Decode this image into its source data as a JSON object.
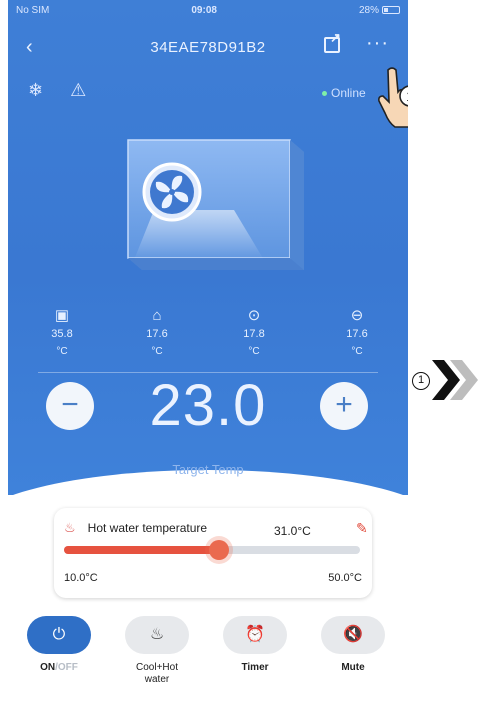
{
  "status_bar": {
    "carrier": "No SIM",
    "time": "09:08",
    "battery": "28%"
  },
  "header": {
    "title": "34EAE78D91B2",
    "back_icon": "chevron-left-icon",
    "share_icon": "share-icon",
    "more_icon": "more-dots-icon"
  },
  "device": {
    "online_text": "Online"
  },
  "step_badge": "1",
  "sensors": [
    {
      "icon": "outdoor-temp-icon",
      "value": "35.8",
      "unit": "°C"
    },
    {
      "icon": "room-temp-icon",
      "value": "17.6",
      "unit": "°C"
    },
    {
      "icon": "inlet-temp-icon",
      "value": "17.8",
      "unit": "°C"
    },
    {
      "icon": "outlet-temp-icon",
      "value": "17.6",
      "unit": "°C"
    }
  ],
  "target": {
    "value": "23.0",
    "label": "Target Temp",
    "minus": "−",
    "plus": "+"
  },
  "hot_water": {
    "label": "Hot water temperature",
    "value": "31.0°C",
    "min": "10.0°C",
    "max": "50.0°C",
    "fraction": 0.525
  },
  "controls": {
    "power": {
      "on": "ON",
      "separator": "/",
      "off": "OFF"
    },
    "mode": {
      "label_line1": "Cool+Hot",
      "label_line2": "water"
    },
    "timer": {
      "label": "Timer"
    },
    "mute": {
      "label": "Mute"
    }
  },
  "colors": {
    "primary": "#3f7fd6",
    "accent": "#e6523f",
    "active_pill": "#2f6fc6"
  }
}
